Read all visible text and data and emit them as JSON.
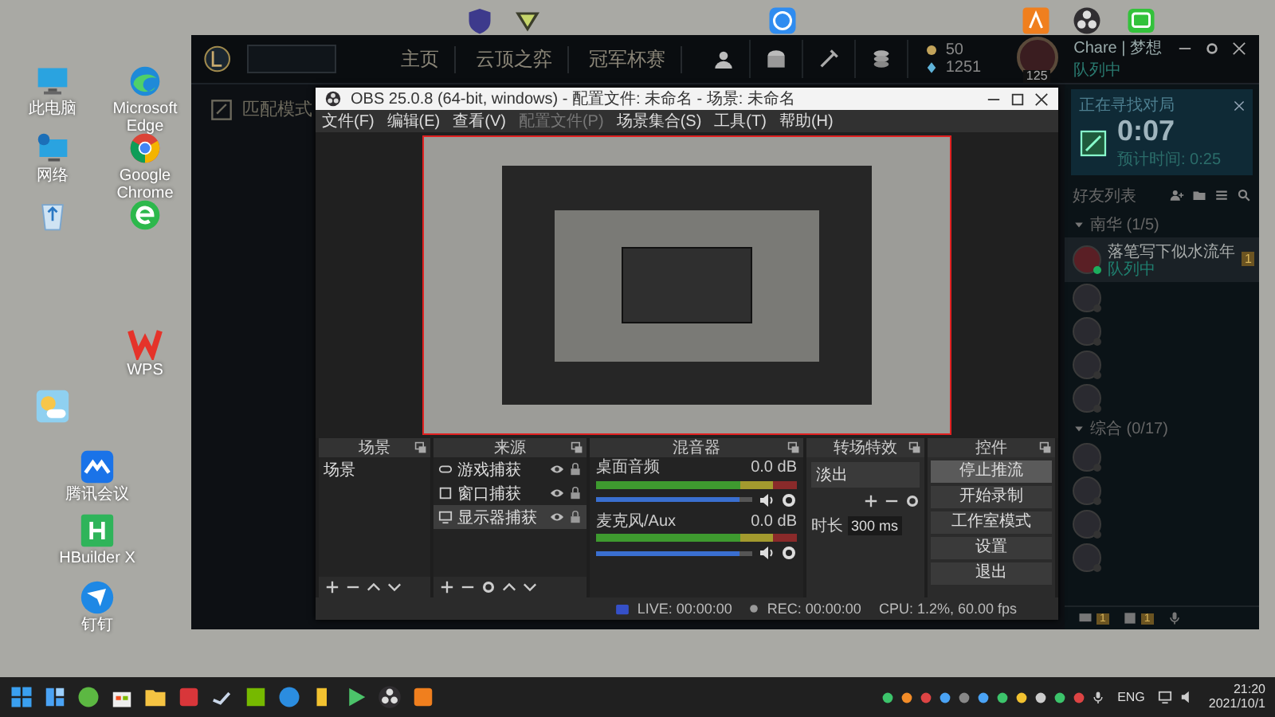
{
  "desktop": {
    "icons": [
      {
        "kind": "pc",
        "label": "此电脑"
      },
      {
        "kind": "edge",
        "label": "Microsoft Edge"
      },
      {
        "kind": "network",
        "label": "网络"
      },
      {
        "kind": "chrome",
        "label": "Google Chrome"
      },
      {
        "kind": "recycle"
      },
      {
        "kind": "browser360"
      },
      {
        "kind": "wps",
        "label": "WPS"
      },
      {
        "kind": "weather"
      },
      {
        "kind": "meeting",
        "label": "腾讯会议"
      },
      {
        "kind": "hbuilder",
        "label": "HBuilder X"
      },
      {
        "kind": "dingtalk",
        "label": "钉钉"
      }
    ],
    "top_icons": [
      {
        "kind": "shield"
      },
      {
        "kind": "triangle"
      },
      {
        "kind": "k"
      },
      {
        "kind": "orange"
      },
      {
        "kind": "obs"
      },
      {
        "kind": "tv"
      }
    ]
  },
  "client": {
    "nav": [
      "主页",
      "云顶之弈",
      "冠军杯赛"
    ],
    "currency": [
      {
        "kind": "essence",
        "value": "50"
      },
      {
        "kind": "points",
        "value": "1251"
      }
    ],
    "profile": {
      "name": "Chare | 梦想",
      "status": "队列中",
      "level": "125"
    },
    "mode_label": "匹配模式",
    "queue": {
      "title": "正在寻找对局",
      "time": "0:07",
      "estimate": "预计时间: 0:25"
    },
    "friends": {
      "title": "好友列表",
      "groups": [
        {
          "name": "南华 (1/5)",
          "expanded": true,
          "members": [
            {
              "name": "落笔写下似水流年",
              "status": "队列中",
              "online": true,
              "badge": "1"
            },
            {
              "online": false
            },
            {
              "online": false
            },
            {
              "online": false
            },
            {
              "online": false
            }
          ]
        },
        {
          "name": "综合 (0/17)",
          "expanded": true,
          "members": [
            {
              "online": false
            },
            {
              "online": false
            },
            {
              "online": false
            },
            {
              "online": false
            }
          ]
        }
      ]
    },
    "bottom_badges": [
      "1",
      "1"
    ]
  },
  "obs": {
    "title": "OBS 25.0.8 (64-bit, windows) - 配置文件: 未命名 - 场景: 未命名",
    "menu": [
      {
        "label": "文件(F)",
        "disabled": false
      },
      {
        "label": "编辑(E)",
        "disabled": false
      },
      {
        "label": "查看(V)",
        "disabled": false
      },
      {
        "label": "配置文件(P)",
        "disabled": true
      },
      {
        "label": "场景集合(S)",
        "disabled": false
      },
      {
        "label": "工具(T)",
        "disabled": false
      },
      {
        "label": "帮助(H)",
        "disabled": false
      }
    ],
    "scenes": {
      "title": "场景",
      "items": [
        {
          "label": "场景",
          "selected": false
        }
      ]
    },
    "sources": {
      "title": "来源",
      "items": [
        {
          "label": "游戏捕获",
          "kind": "game",
          "selected": false
        },
        {
          "label": "窗口捕获",
          "kind": "window",
          "selected": false
        },
        {
          "label": "显示器捕获",
          "kind": "display",
          "selected": true
        }
      ]
    },
    "mixer": {
      "title": "混音器",
      "channels": [
        {
          "name": "桌面音频",
          "reading": "0.0 dB",
          "level": 0.92
        },
        {
          "name": "麦克风/Aux",
          "reading": "0.0 dB",
          "level": 0.92
        }
      ]
    },
    "transitions": {
      "title": "转场特效",
      "type": "淡出",
      "duration_label": "时长",
      "duration": "300 ms"
    },
    "controls": {
      "title": "控件",
      "buttons": [
        {
          "label": "停止推流",
          "highlighted": true
        },
        {
          "label": "开始录制",
          "highlighted": false
        },
        {
          "label": "工作室模式",
          "highlighted": false
        },
        {
          "label": "设置",
          "highlighted": false
        },
        {
          "label": "退出",
          "highlighted": false
        }
      ]
    },
    "status": {
      "live": "LIVE: 00:00:00",
      "rec": "REC: 00:00:00",
      "cpu": "CPU: 1.2%, 60.00 fps"
    }
  },
  "taskbar": {
    "apps": [
      {
        "kind": "start"
      },
      {
        "kind": "widgets"
      },
      {
        "kind": "xbox"
      },
      {
        "kind": "store"
      },
      {
        "kind": "folder"
      },
      {
        "kind": "red"
      },
      {
        "kind": "steam"
      },
      {
        "kind": "nvidia"
      },
      {
        "kind": "edge"
      },
      {
        "kind": "yellow"
      },
      {
        "kind": "player"
      },
      {
        "kind": "obs"
      },
      {
        "kind": "orange"
      }
    ],
    "language": "ENG",
    "time": "21:20",
    "date": "2021/10/1"
  }
}
